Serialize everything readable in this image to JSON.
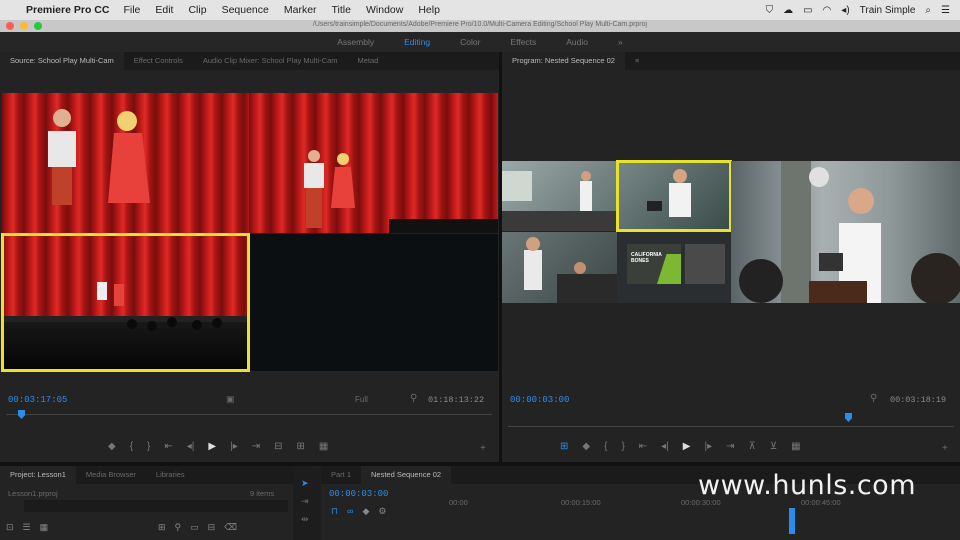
{
  "menubar": {
    "app": "Premiere Pro CC",
    "items": [
      "File",
      "Edit",
      "Clip",
      "Sequence",
      "Marker",
      "Title",
      "Window",
      "Help"
    ],
    "user": "Train Simple"
  },
  "titlebar": {
    "title": "/Users/trainsimple/Documents/Adobe/Premiere Pro/10.0/Multi-Camera Editing/School Play Multi-Cam.prproj"
  },
  "workspaces": {
    "items": [
      "Assembly",
      "Editing",
      "Color",
      "Effects",
      "Audio"
    ],
    "active": "Editing"
  },
  "source": {
    "tabs": [
      "Source: School Play Multi-Cam",
      "Effect Controls",
      "Audio Clip Mixer: School Play Multi-Cam",
      "Metad"
    ],
    "timecode": "00:03:17:05",
    "fit": "Full",
    "duration": "01:18:13:22"
  },
  "program": {
    "tabs": [
      "Program: Nested Sequence 02"
    ],
    "timecode": "00:00:03:00",
    "duration": "00:03:18:19"
  },
  "project": {
    "tabs": [
      "Project: Lesson1",
      "Media Browser",
      "Libraries"
    ],
    "file": "Lesson1.prproj",
    "items": "9 items"
  },
  "timeline": {
    "tabs": [
      "Part 1",
      "Nested Sequence 02"
    ],
    "timecode": "00:00:03:00",
    "ruler": [
      "00:00",
      "00:00:15:00",
      "00:00:30:00",
      "00:00:45:00"
    ]
  },
  "slide": {
    "title": "CALIFORNIA BONES"
  },
  "watermark": "www.hunls.com",
  "colors": {
    "accent": "#2d8ceb",
    "highlight": "#e8e22c"
  }
}
